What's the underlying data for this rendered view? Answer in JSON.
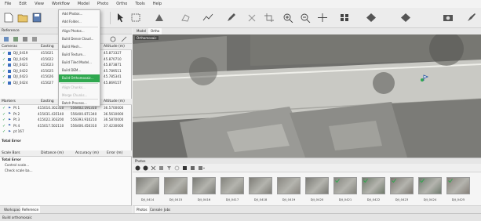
{
  "menu": [
    "File",
    "Edit",
    "View",
    "Workflow",
    "Model",
    "Photo",
    "Ortho",
    "Tools",
    "Help"
  ],
  "workspace": {
    "header": "Reference",
    "cameras_header": [
      "Cameras",
      "Easting",
      "Northing",
      "Altitude (m)"
    ],
    "cameras": [
      {
        "name": "DJI_0419",
        "easting": "415021",
        "northing": "556402",
        "alt": "45.873327"
      },
      {
        "name": "DJI_0420",
        "easting": "415022",
        "northing": "556402",
        "alt": "45.870710"
      },
      {
        "name": "DJI_0421",
        "easting": "415023",
        "northing": "556402",
        "alt": "45.873871"
      },
      {
        "name": "DJI_0422",
        "easting": "415025",
        "northing": "556403",
        "alt": "45.789511"
      },
      {
        "name": "DJI_0423",
        "easting": "415026",
        "northing": "556403",
        "alt": "45.785341"
      },
      {
        "name": "DJI_0424",
        "easting": "415027",
        "northing": "556404",
        "alt": "45.869157"
      }
    ],
    "markers_header": [
      "Markers",
      "Easting",
      "Northing",
      "Altitude (m)"
    ],
    "markers": [
      {
        "name": "Pt 1",
        "easting": "415010.302310",
        "northing": "556402.191310",
        "alt": "36.5700000"
      },
      {
        "name": "Pt 2",
        "easting": "415031.435140",
        "northing": "556400.871340",
        "alt": "36.5610000"
      },
      {
        "name": "Pt 3",
        "easting": "415022.303200",
        "northing": "556393.910210",
        "alt": "36.5870000"
      },
      {
        "name": "Pt 4",
        "easting": "415017.502110",
        "northing": "556406.450310",
        "alt": "37.4230000"
      },
      {
        "name": "pt 167",
        "easting": "",
        "northing": "",
        "alt": ""
      }
    ],
    "total_error": "Total Error",
    "scalebars_header": [
      "Scale Bars",
      "Distance (m)",
      "Accuracy (m)",
      "Error (m)"
    ],
    "scalebar_rows": [
      "Total Error",
      "Control scale...",
      "Check scale ba..."
    ],
    "bottom_tabs": [
      "Workspace",
      "Reference"
    ]
  },
  "dropdown": {
    "items": [
      {
        "label": "Add Photos...",
        "state": "normal"
      },
      {
        "label": "Add Folder...",
        "state": "normal"
      },
      {
        "label": "Align Photos...",
        "state": "normal"
      },
      {
        "label": "Build Dense Cloud...",
        "state": "normal"
      },
      {
        "label": "Build Mesh...",
        "state": "normal"
      },
      {
        "label": "Build Texture...",
        "state": "normal"
      },
      {
        "label": "Build Tiled Model...",
        "state": "normal"
      },
      {
        "label": "Build DEM...",
        "state": "normal"
      },
      {
        "label": "Build Orthomosaic...",
        "state": "highlighted"
      },
      {
        "label": "Align Chunks...",
        "state": "disabled"
      },
      {
        "label": "Merge Chunks...",
        "state": "disabled"
      },
      {
        "label": "Batch Process...",
        "state": "normal"
      }
    ]
  },
  "map": {
    "tabs": [
      "Model",
      "Ortho"
    ],
    "chunk_label": "Orthomosaic"
  },
  "photos": {
    "header": "Photos",
    "thumbs": [
      "DJI_0414",
      "DJI_0415",
      "DJI_0416",
      "DJI_0417",
      "DJI_0418",
      "DJI_0419",
      "DJI_0420",
      "DJI_0421",
      "DJI_0422",
      "DJI_0423",
      "DJI_0424",
      "DJI_0425"
    ],
    "bottom_tabs": [
      "Photos",
      "Console",
      "Jobs"
    ]
  },
  "status": "Build orthomosaic",
  "colors": {
    "accent": "#2fa84f",
    "check": "#2aa048"
  }
}
